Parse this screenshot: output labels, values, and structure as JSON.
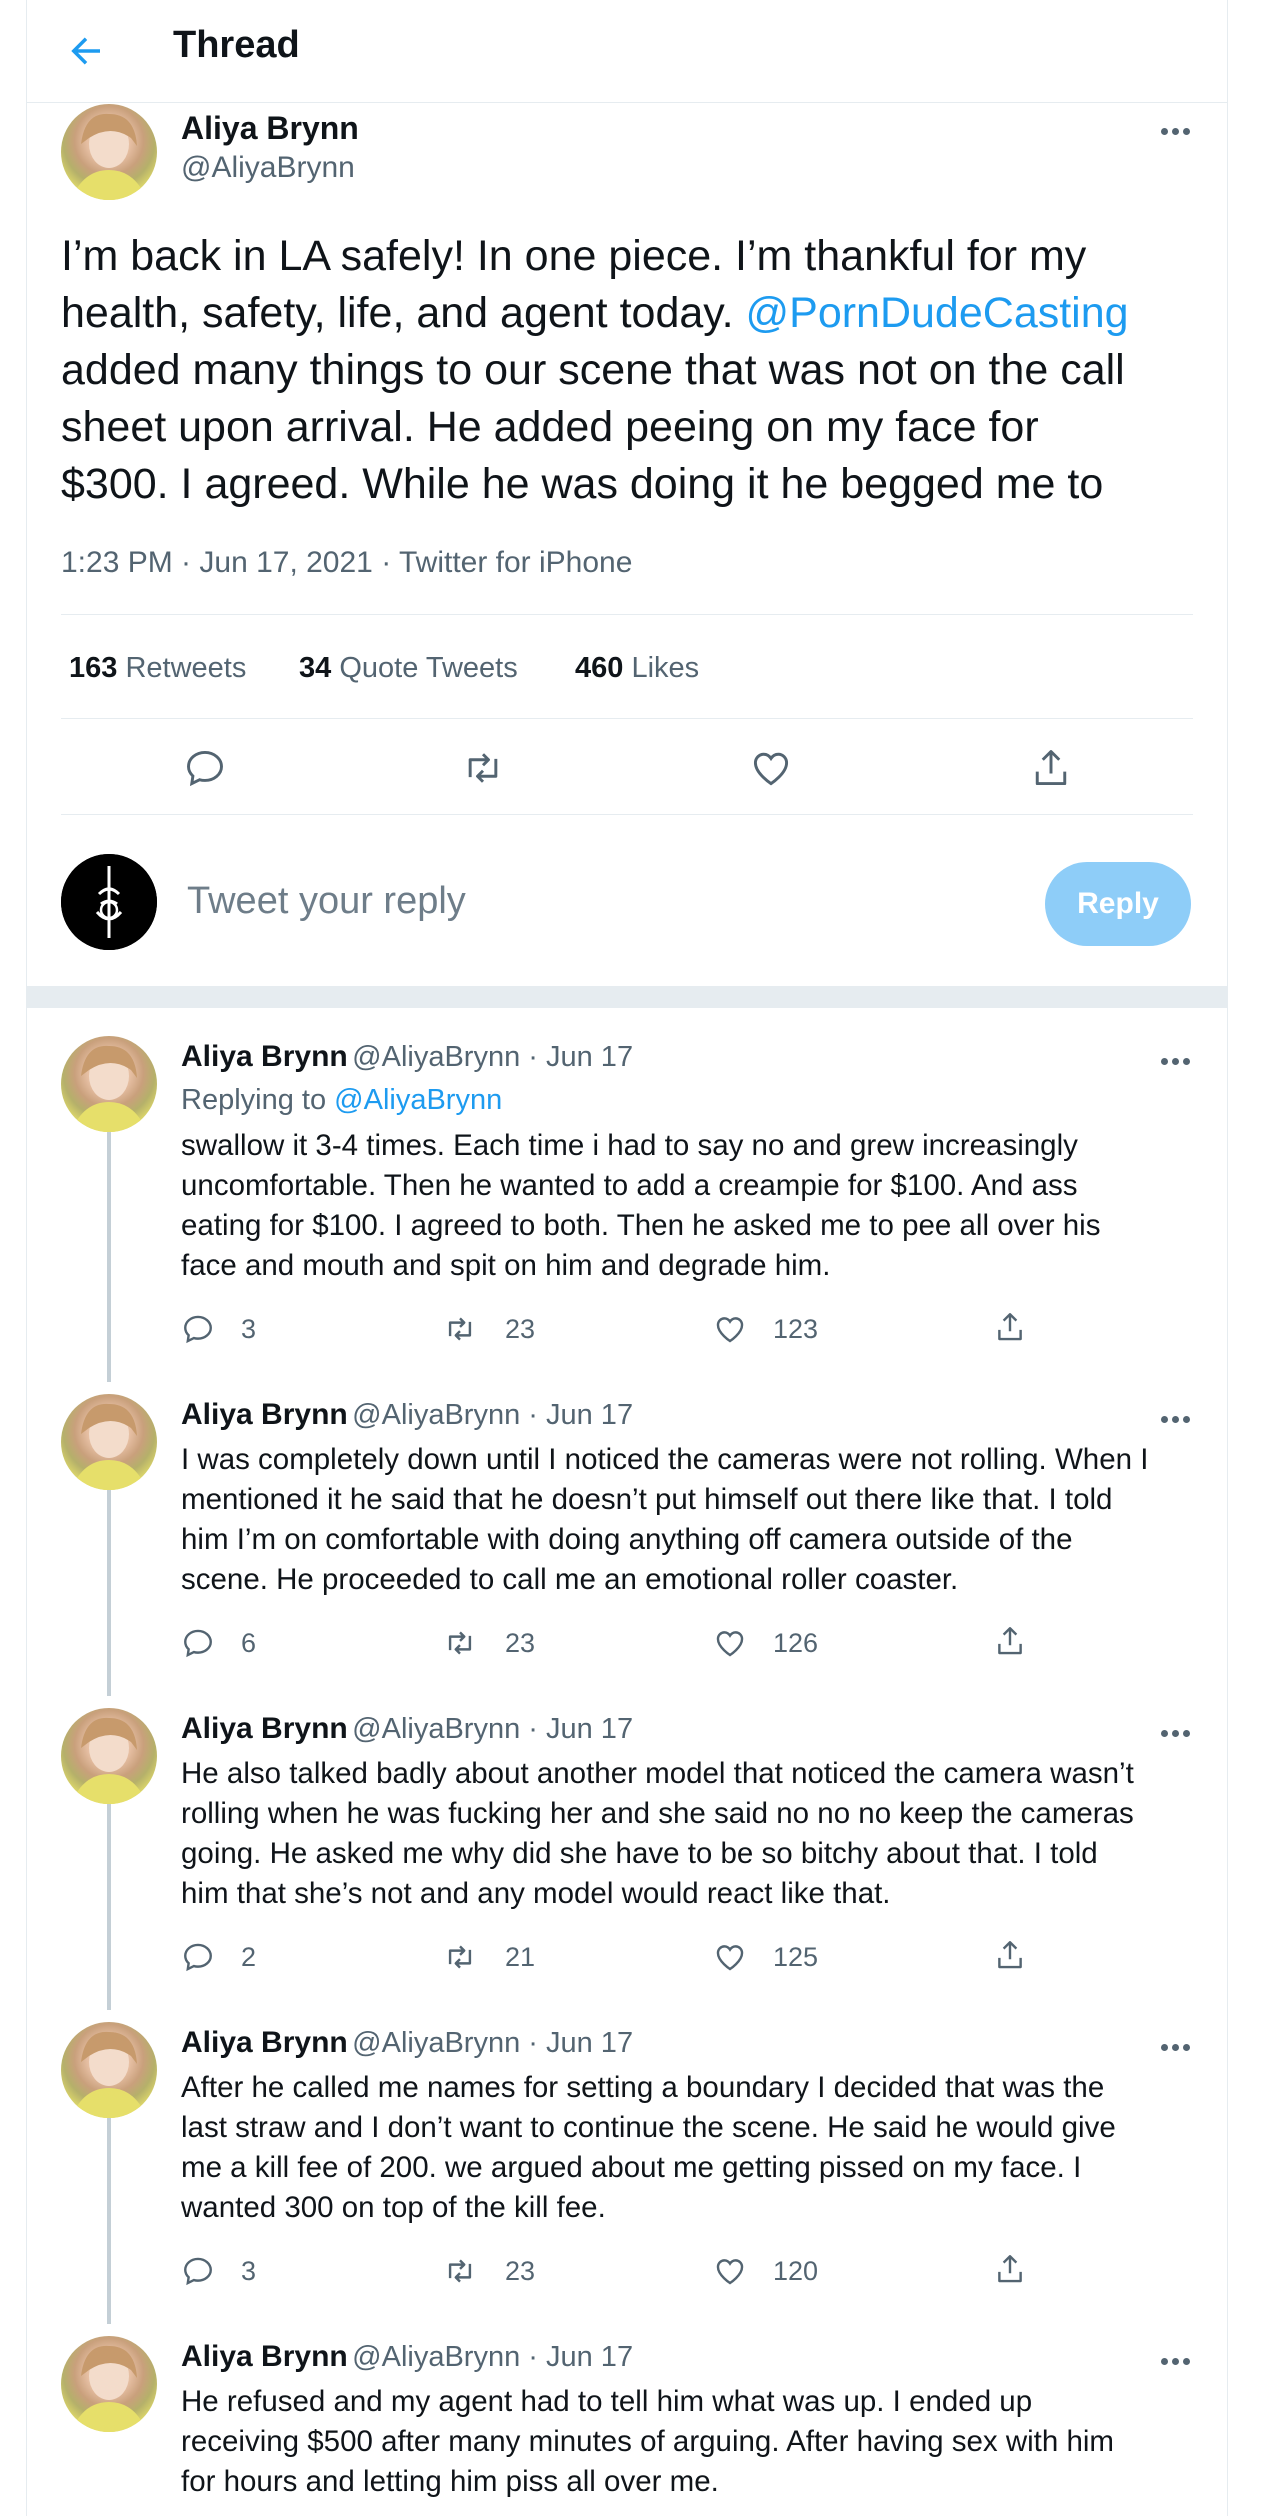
{
  "header": {
    "title": "Thread"
  },
  "main_tweet": {
    "name": "Aliya Brynn",
    "handle": "@AliyaBrynn",
    "text_parts": [
      "I’m back in LA safely! In one piece. I’m thankful for my health, safety, life, and agent today. ",
      "@PornDudeCasting",
      " added many things to our scene that was not on the call sheet upon arrival. He added peeing on my face for $300. I agreed. While he was doing it he begged me to"
    ],
    "lines": [
      "I’m back in LA safely! In one piece. I’m thankful for my",
      "health, safety, life, and agent today.",
      "@PornDudeCasting",
      "added many things to our scene that was not on the call",
      "sheet upon arrival. He added peeing on my face for",
      "$300. I agreed. While he was doing it he begged me to"
    ],
    "timestamp": "1:23 PM · Jun 17, 2021 · Twitter for iPhone",
    "stats": {
      "retweets_count": "163",
      "retweets_label": "Retweets",
      "quotes_count": "34",
      "quotes_label": "Quote Tweets",
      "likes_count": "460",
      "likes_label": "Likes"
    }
  },
  "compose": {
    "placeholder": "Tweet your reply",
    "button": "Reply"
  },
  "replies": [
    {
      "name": "Aliya Brynn",
      "handle_time": "@AliyaBrynn · Jun 17",
      "replying_label": "Replying to",
      "replying_to": "@AliyaBrynn",
      "lines": [
        "swallow it 3-4 times. Each time i had to say no and grew increasingly",
        "uncomfortable. Then he wanted to add a creampie for $100. And ass",
        "eating for $100. I agreed to both. Then he asked me to pee all over his",
        "face and mouth and spit on him and degrade him."
      ],
      "replies": "3",
      "retweets": "23",
      "likes": "123"
    },
    {
      "name": "Aliya Brynn",
      "handle_time": "@AliyaBrynn · Jun 17",
      "lines": [
        "I was completely down until I noticed the cameras were not rolling. When I",
        "mentioned it he said that he doesn’t put himself out there like that. I told",
        "him I’m on comfortable with doing anything off camera outside of the",
        "scene. He proceeded to call me an emotional roller coaster."
      ],
      "replies": "6",
      "retweets": "23",
      "likes": "126"
    },
    {
      "name": "Aliya Brynn",
      "handle_time": "@AliyaBrynn · Jun 17",
      "lines": [
        "He also talked badly about another model that noticed the camera wasn’t",
        "rolling when he was fucking her and she said no no no keep the cameras",
        "going. He asked me why did she have to be so bitchy about that. I told",
        "him that she’s not and any model would react like that."
      ],
      "replies": "2",
      "retweets": "21",
      "likes": "125"
    },
    {
      "name": "Aliya Brynn",
      "handle_time": "@AliyaBrynn · Jun 17",
      "lines": [
        "After he called me names for setting a boundary I decided that was the",
        "last straw and I don’t want to continue the scene. He said he would give",
        "me a kill fee of 200. we argued about me getting pissed on my face. I",
        "wanted 300 on top of the kill fee."
      ],
      "replies": "3",
      "retweets": "23",
      "likes": "120"
    },
    {
      "name": "Aliya Brynn",
      "handle_time": "@AliyaBrynn · Jun 17",
      "lines": [
        "He refused and my agent had to tell him what was up. I ended up",
        "receiving $500 after many minutes of arguing. After having sex with him",
        "for hours and letting him piss all over me."
      ]
    }
  ],
  "colors": {
    "accent": "#1d9bf0",
    "reply_button": "#8ecdf8",
    "muted": "#536471"
  },
  "icons": [
    "back-arrow-icon",
    "more-icon",
    "reply-icon",
    "retweet-icon",
    "like-icon",
    "share-icon"
  ]
}
